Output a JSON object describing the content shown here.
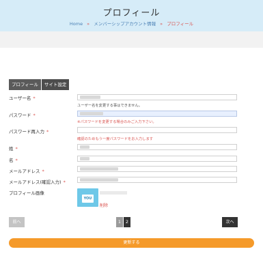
{
  "header": {
    "title": "プロフィール",
    "breadcrumb": {
      "home": "Home",
      "account": "メンバーシップアカウント情報",
      "current": "プロフィール",
      "separator": "»"
    }
  },
  "tabs": [
    "プロフィール",
    "サイト設定"
  ],
  "form": {
    "username_label": "ユーザー名",
    "username_hint": "ユーザー名を変更する事はできません。",
    "password_label": "パスワード",
    "password_hint": "※パスワードを変更する場合のみご入力下さい。",
    "password_confirm_label": "パスワード再入力",
    "password_confirm_hint": "確認のためもう一度パスワードをお入力します",
    "last_name_label": "姓",
    "first_name_label": "名",
    "email_label": "メールアドレス",
    "email_confirm_label": "メールアドレス(確認入力)",
    "profile_image_label": "プロフィール画像",
    "avatar_text": "YOU",
    "delete_label": "削除",
    "required_mark": "*"
  },
  "pagination": {
    "prev": "前へ",
    "pages": [
      "1",
      "2"
    ],
    "next": "次へ"
  },
  "submit_label": "更新する",
  "colors": {
    "header_bg": "#d6ecf8",
    "accent_red": "#d9534f",
    "update_button": "#f59a2a",
    "dark_button": "#333333"
  }
}
